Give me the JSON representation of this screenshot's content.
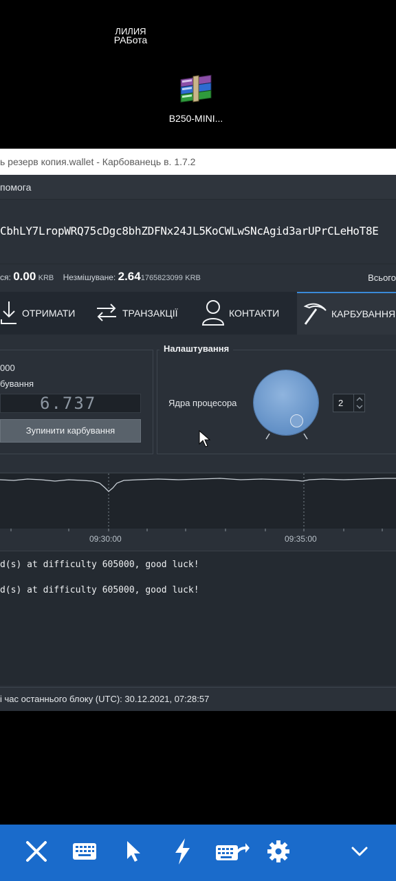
{
  "desktop": {
    "icon1_cut_label": "ЛИЛИЯ",
    "icon1_label": "РАБота",
    "icon2_label": "B250-MINI..."
  },
  "window": {
    "title": "ь резерв копия.wallet - Карбованець в. 1.7.2",
    "menu_item": "помога",
    "address": "CbhLY7LropWRQ75cDgc8bhZDFNx24JL5KoCWLwSNcAgid3arUPrCLeHoT8E",
    "balance": {
      "available_label": "ся:",
      "available_value": "0.00",
      "unit": "KRB",
      "unmixed_label": "Незмішуване:",
      "unmixed_big": "2.64",
      "unmixed_small": "1765823099",
      "total_label": "Всього"
    },
    "tabs": [
      {
        "label": "ОТРИМАТИ"
      },
      {
        "label": "ТРАНЗАКЦІЇ"
      },
      {
        "label": "КОНТАКТИ"
      },
      {
        "label": "КАРБУВАННЯ"
      }
    ],
    "mining": {
      "left_value_line": "000",
      "left_label_line": "бування",
      "hashrate": "6.737",
      "stop_button": "Зупинити карбування",
      "settings_title": "Налаштування",
      "cores_label": "Ядра процесора",
      "cores_value": "2"
    },
    "chart": {
      "ticks": [
        "09:30:00",
        "09:35:00"
      ]
    },
    "log_lines": [
      "d(s) at difficulty 605000, good luck!",
      "d(s) at difficulty 605000, good luck!"
    ],
    "status": "і час останнього блоку (UTC): 30.12.2021, 07:28:57"
  },
  "toolbar": {
    "buttons": [
      "close-icon",
      "keyboard-icon",
      "pointer-icon",
      "lightning-icon",
      "keyboard-send-icon",
      "gear-icon",
      "chevron-down-icon"
    ]
  },
  "colors": {
    "toolbar_bg": "#1a6bcb",
    "window_bg": "#2a3038",
    "accent": "#3a8ad8",
    "knob": "#6f9bd1"
  }
}
